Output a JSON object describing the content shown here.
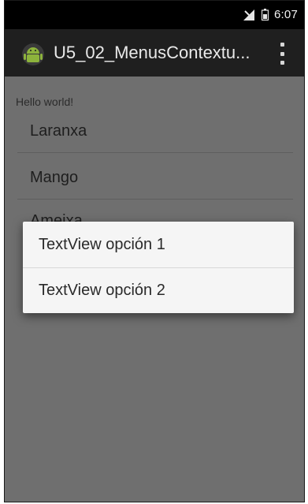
{
  "status_bar": {
    "time": "6:07",
    "icons": [
      "signal-icon",
      "battery-icon"
    ]
  },
  "action_bar": {
    "title": "U5_02_MenusContextu...",
    "app_icon": "android-icon",
    "overflow_icon": "overflow-menu-icon"
  },
  "content": {
    "hello_text": "Hello world!",
    "list_items": [
      "Laranxa",
      "Mango",
      "Ameixa"
    ]
  },
  "context_menu": {
    "options": [
      "TextView opción 1",
      "TextView opción 2"
    ]
  },
  "colors": {
    "status_bar_bg": "#000000",
    "action_bar_bg": "#1f1f1f",
    "dimmed_content_bg": "#6f6f6f",
    "popup_bg": "#f5f5f5"
  }
}
